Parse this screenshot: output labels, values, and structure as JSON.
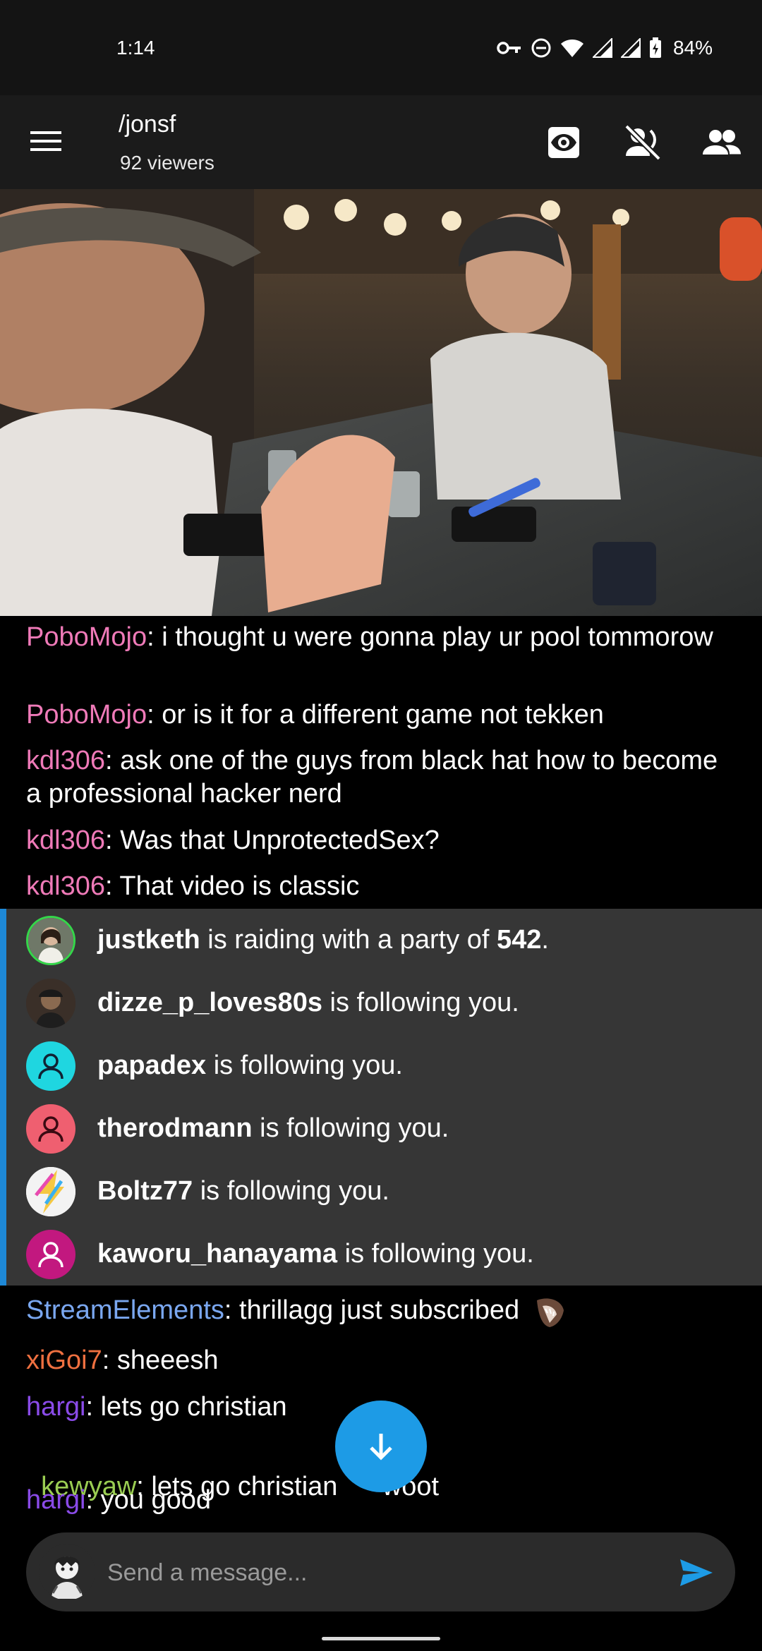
{
  "status_bar": {
    "time": "1:14",
    "battery": "84%",
    "icons": [
      "vpn-key-icon",
      "do-not-disturb-icon",
      "wifi-icon",
      "cell-signal-icon",
      "cell-signal-icon",
      "battery-charging-icon"
    ]
  },
  "app_bar": {
    "channel": "/jonsf",
    "viewers": "92 viewers",
    "icons": [
      "menu-icon",
      "eye-icon",
      "mic-off-icon",
      "users-icon"
    ]
  },
  "chat": {
    "messages": [
      {
        "user": "PoboMojo",
        "text": ": i thought u were gonna play ur pool tommorow",
        "color": "#ef7ab8"
      },
      {
        "user": "PoboMojo",
        "text": ": or is it for a different game not tekken",
        "color": "#ef7ab8"
      },
      {
        "user": "kdl306",
        "text": ": ask one of the guys from black hat how to become a professional hacker nerd",
        "color": "#ef7ab8"
      },
      {
        "user": "kdl306",
        "text": ": Was that UnprotectedSex?",
        "color": "#ef7ab8"
      },
      {
        "user": "kdl306",
        "text": ": That video is classic",
        "color": "#ef7ab8"
      }
    ],
    "events": [
      {
        "name": "justketh",
        "suffix": " is raiding with a party of ",
        "count": "542",
        "end": ".",
        "avatar_color": "#3a4a3a"
      },
      {
        "name": "dizze_p_loves80s",
        "suffix": " is following you.",
        "avatar_color": "#3a2f28"
      },
      {
        "name": "papadex",
        "suffix": " is following you.",
        "avatar_color": "#1fd6e0"
      },
      {
        "name": "therodmann",
        "suffix": " is following you.",
        "avatar_color": "#ef5f70"
      },
      {
        "name": "Boltz77",
        "suffix": " is following you.",
        "avatar_color": "#f3f3f3"
      },
      {
        "name": "kaworu_hanayama",
        "suffix": " is following you.",
        "avatar_color": "#c2187f"
      }
    ],
    "messages_after": [
      {
        "user": "StreamElements",
        "text": ": thrillagg just subscribed",
        "color": "#7aa7f0"
      },
      {
        "user": "xiGoi7",
        "text": ": sheeesh",
        "color": "#ef7040"
      },
      {
        "user": "hargi",
        "text": ": lets go christian",
        "color": "#8a4be8"
      },
      {
        "user": "kewyaw",
        "text": ": lets go christian      woot",
        "color": "#9acd52"
      },
      {
        "user": "hargi",
        "text": ": you good",
        "color": "#8a4be8"
      }
    ]
  },
  "composer": {
    "placeholder": "Send a message..."
  },
  "colors": {
    "accent": "#1d9be6",
    "event_border": "#1e88d6"
  }
}
